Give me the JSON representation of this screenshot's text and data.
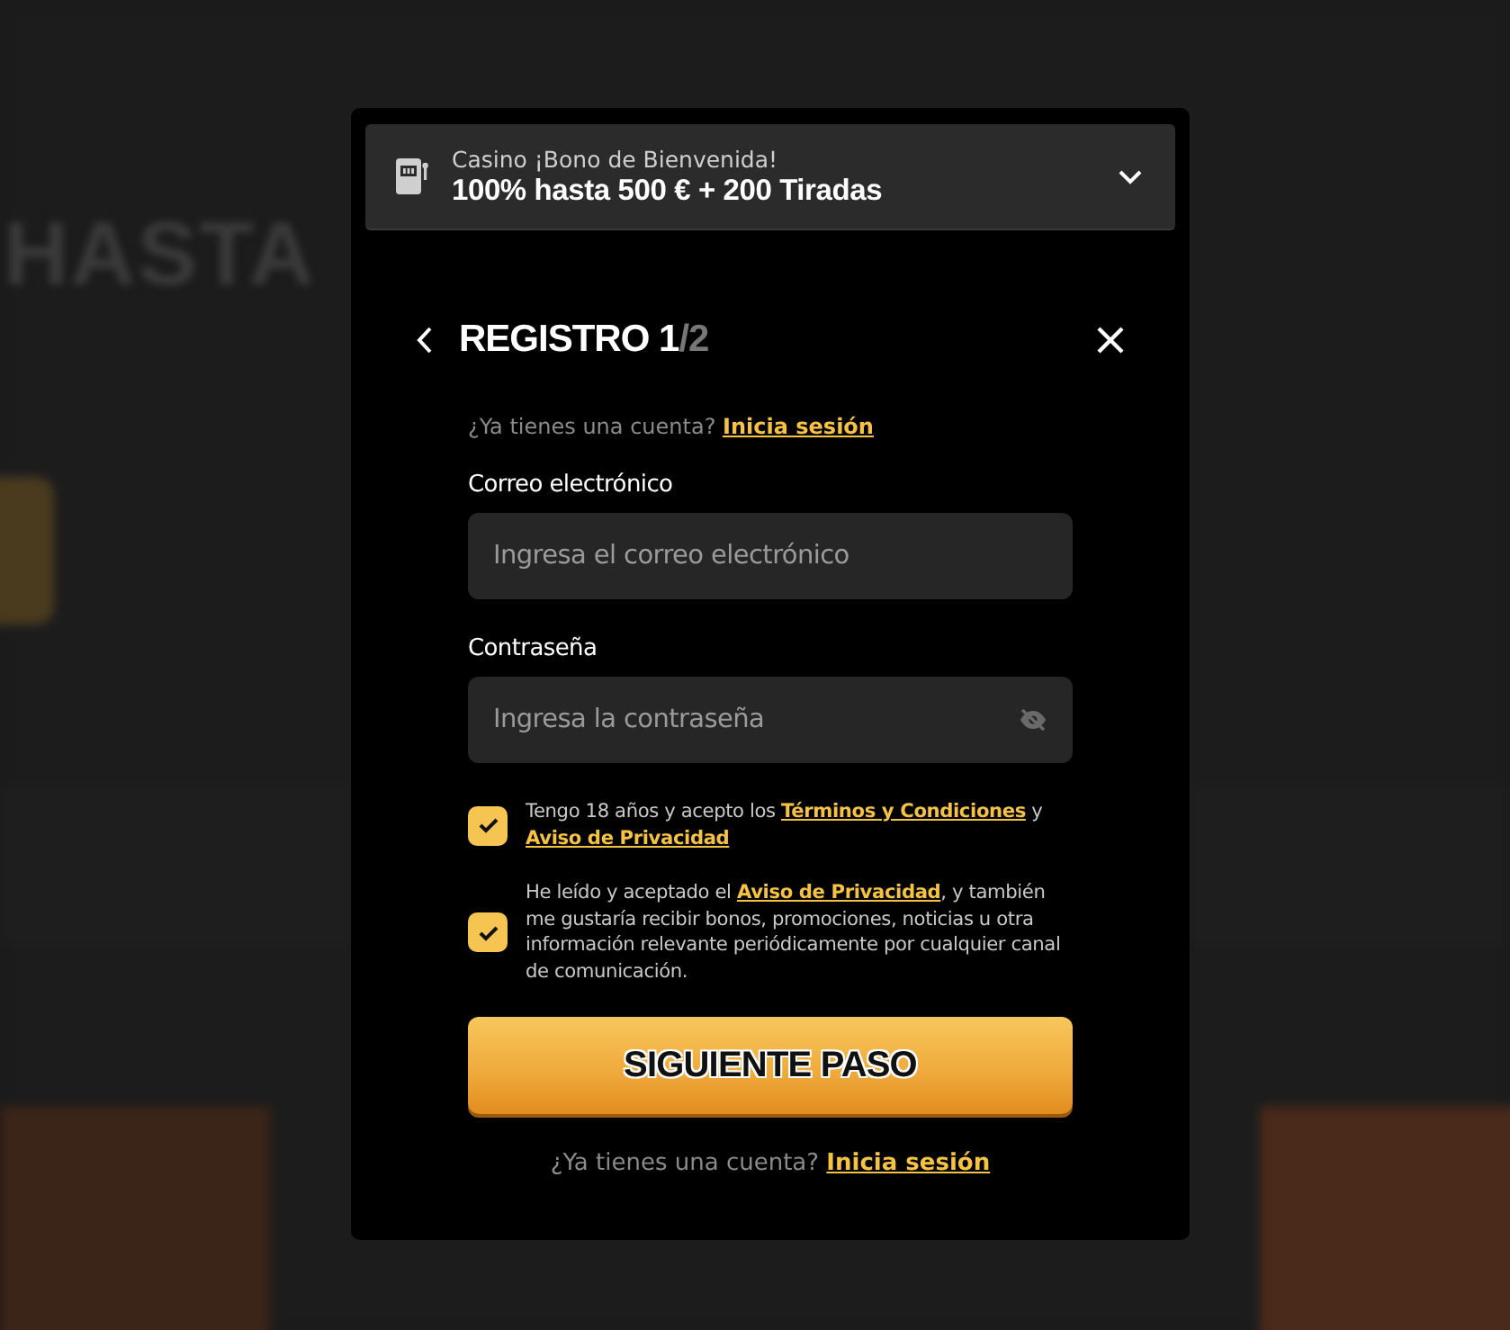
{
  "backdrop": {
    "headline": "HASTA"
  },
  "promo": {
    "caption": "Casino ¡Bono de Bienvenida!",
    "offer": "100% hasta 500 € + 200 Tiradas",
    "expanded": false
  },
  "dialog": {
    "title": [
      {
        "text": "REGISTRO 1",
        "muted": false
      },
      {
        "text": "/2",
        "muted": true
      }
    ],
    "login_prompt": {
      "text": "¿Ya tienes una cuenta?",
      "link": "Inicia sesión"
    },
    "fields": [
      {
        "label": "Correo electrónico",
        "placeholder": "Ingresa el correo electrónico",
        "kind": "email"
      },
      {
        "label": "Contraseña",
        "placeholder": "Ingresa la contraseña",
        "kind": "password"
      }
    ],
    "consents": [
      {
        "checked": true,
        "parts": [
          {
            "kind": "text",
            "text": "Tengo 18 años y acepto los "
          },
          {
            "kind": "link",
            "text": "Términos y Condiciones"
          },
          {
            "kind": "text",
            "text": " y "
          },
          {
            "kind": "link",
            "text": "Aviso de Privacidad"
          }
        ]
      },
      {
        "checked": true,
        "parts": [
          {
            "kind": "text",
            "text": "He leído y aceptado el "
          },
          {
            "kind": "link",
            "text": "Aviso de Privacidad"
          },
          {
            "kind": "text",
            "text": ", y también me gustaría recibir bonos, promociones, noticias u otra información relevante periódicamente por cualquier canal de comunicación."
          }
        ]
      }
    ],
    "submit": "SIGUIENTE PASO",
    "footer_prompt": {
      "text": "¿Ya tienes una cuenta?",
      "link": "Inicia sesión"
    }
  }
}
